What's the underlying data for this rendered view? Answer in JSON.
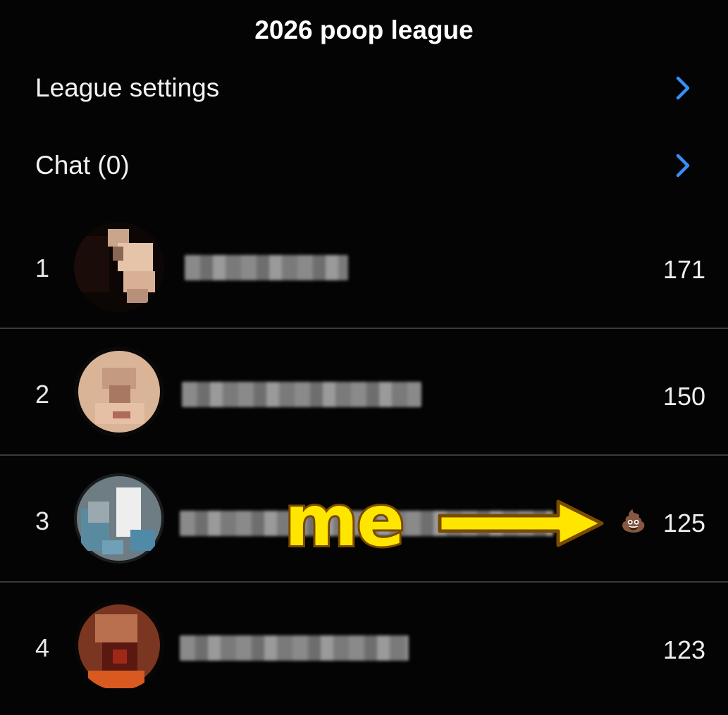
{
  "header": {
    "title": "2026 poop league"
  },
  "menu": [
    {
      "label": "League settings",
      "icon": "chevron-right-icon"
    },
    {
      "label": "Chat (0)",
      "icon": "chevron-right-icon"
    }
  ],
  "standings": [
    {
      "rank": "1",
      "score": "171",
      "badge": ""
    },
    {
      "rank": "2",
      "score": "150",
      "badge": ""
    },
    {
      "rank": "3",
      "score": "125",
      "badge": "💩"
    },
    {
      "rank": "4",
      "score": "123",
      "badge": ""
    }
  ],
  "annotation": {
    "text": "me",
    "color": "#ffe600",
    "outline": "#7a4a00"
  },
  "colors": {
    "accent": "#3a8df6",
    "background": "#040404",
    "divider": "#3a3a3a"
  }
}
